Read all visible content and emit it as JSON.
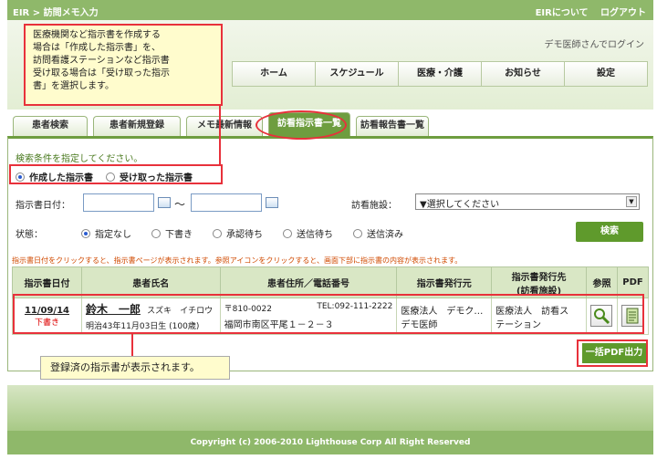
{
  "topbar": {
    "breadcrumb": "EIR > 訪問メモ入力",
    "about": "EIRについて",
    "logout": "ログアウト"
  },
  "header": {
    "login_text": "デモ医師さんでログイン"
  },
  "nav": [
    "ホーム",
    "スケジュール",
    "医療・介護",
    "お知らせ",
    "設定"
  ],
  "tabs": [
    "患者検索",
    "患者新規登録",
    "メモ最新情報",
    "訪看指示書一覧",
    "訪看報告書一覧"
  ],
  "search": {
    "instruction": "検索条件を指定してください。",
    "type_options": [
      "作成した指示書",
      "受け取った指示書"
    ],
    "date_label": "指示書日付：",
    "tilde": "〜",
    "facility_label": "訪看施設：",
    "facility_value": "▼選択してください",
    "status_label": "状態：",
    "status_options": [
      "指定なし",
      "下書き",
      "承認待ち",
      "送信待ち",
      "送信済み"
    ],
    "search_button": "検索",
    "note": "指示書日付をクリックすると、指示書ページが表示されます。参照アイコンをクリックすると、画面下部に指示書の内容が表示されます。"
  },
  "table": {
    "headers": [
      "指示書日付",
      "患者氏名",
      "患者住所／電話番号",
      "指示書発行元",
      "指示書発行先",
      "(訪看施設)",
      "参照",
      "PDF"
    ],
    "rows": [
      {
        "date": "11/09/14",
        "status": "下書き",
        "name": "鈴木　一郎",
        "kana": "スズキ　イチロウ",
        "birth": "明治43年11月03日生 (100歳)",
        "zip": "〒810-0022",
        "tel": "TEL:092-111-2222",
        "address": "福岡市南区平尾１－２－３",
        "issuer": "医療法人　デモク…",
        "issuer2": "デモ医師",
        "dest": "医療法人　訪看ス",
        "dest2": "テーション"
      }
    ]
  },
  "bulk_button": "一括PDF出力",
  "footer": {
    "copyright": "Copyright (c) 2006-2010 Lighthouse Corp All Right Reserved"
  },
  "callouts": {
    "top": [
      "医療機関など指示書を作成する",
      "場合は「作成した指示書」を、",
      "訪問看護ステーションなど指示書",
      "受け取る場合は「受け取った指示",
      "書」を選択します。"
    ],
    "bottom": "登録済の指示書が表示されます。"
  }
}
